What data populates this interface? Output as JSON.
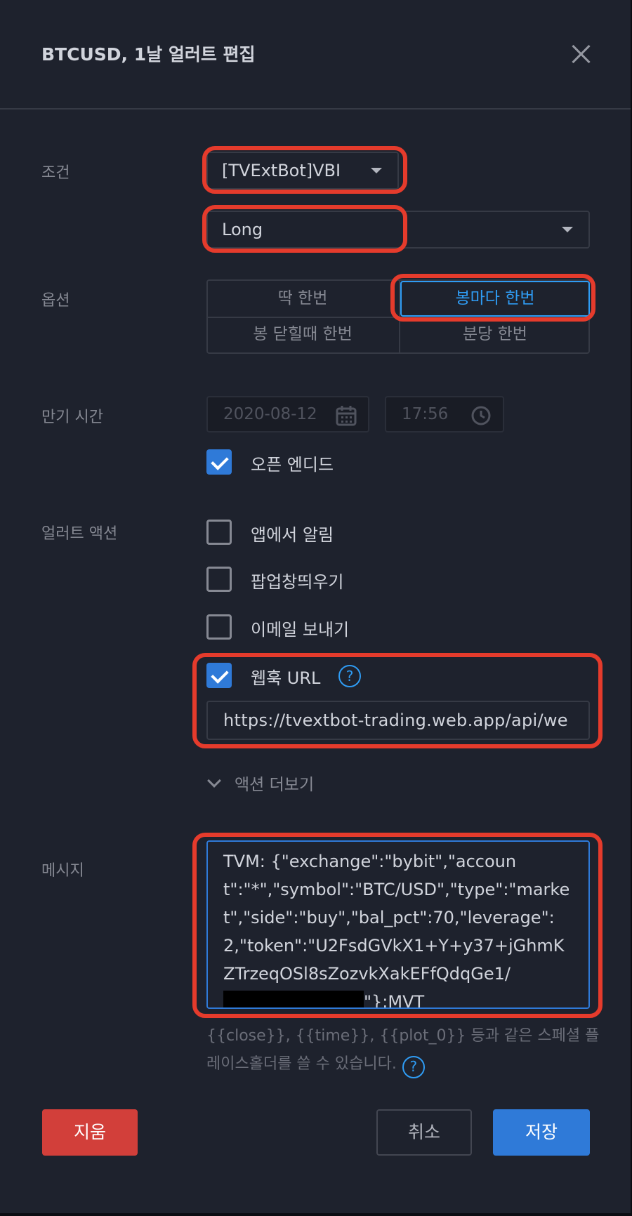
{
  "dialog": {
    "title": "BTCUSD, 1날 얼러트 편집"
  },
  "condition": {
    "label": "조건",
    "indicator": "[TVExtBot]VBI",
    "signal": "Long"
  },
  "options": {
    "label": "옵션",
    "items": [
      "딱 한번",
      "봉마다 한번",
      "봉 닫힐때 한번",
      "분당 한번"
    ],
    "selected": "봉마다 한번"
  },
  "expiry": {
    "label": "만기 시간",
    "date": "2020-08-12",
    "time": "17:56",
    "open_ended_label": "오픈 엔디드",
    "open_ended_checked": true
  },
  "actions": {
    "label": "얼러트 액션",
    "items": [
      {
        "label": "앱에서 알림",
        "checked": false
      },
      {
        "label": "팝업창띄우기",
        "checked": false
      },
      {
        "label": "이메일 보내기",
        "checked": false
      },
      {
        "label": "웹훅 URL",
        "checked": true
      }
    ],
    "webhook_url": "https://tvextbot-trading.web.app/api/we",
    "more_label": "액션 더보기"
  },
  "message": {
    "label": "메시지",
    "text_before": "TVM:\n{\"exchange\":\"bybit\",\"account\":\"*\",\"symbol\":\"BTC/USD\",\"type\":\"market\",\"side\":\"buy\",\"bal_pct\":70,\"leverage\":2,\"token\":\"U2FsdGVkX1+Y+y37+jGhmKZTrzeqOSl8sZozvkXakEFfQdqGe1/",
    "text_after": "\"}:MVT",
    "hint": "{{close}}, {{time}}, {{plot_0}} 등과 같은 스페셜 플레이스홀더를 쓸 수 있습니다."
  },
  "buttons": {
    "delete": "지움",
    "cancel": "취소",
    "save": "저장"
  },
  "colors": {
    "accent": "#2f7ad8",
    "highlight": "#e53b2c",
    "danger": "#d23f3a"
  }
}
